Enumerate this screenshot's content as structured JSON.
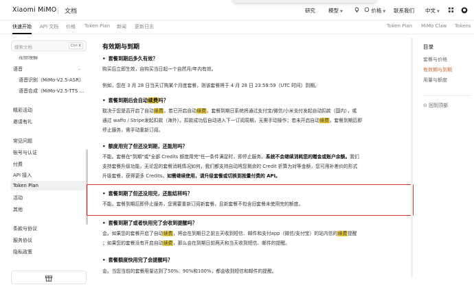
{
  "header": {
    "logo": "Xiaomi MiMO",
    "doc_label": "文档",
    "nav": [
      {
        "label": "研究",
        "chevron": false
      },
      {
        "label": "模型",
        "chevron": true
      },
      {
        "label": "价格",
        "chevron": false
      },
      {
        "label": "联系我们",
        "chevron": false
      },
      {
        "label": "中文",
        "chevron": true
      }
    ],
    "icons": [
      "lightbulb-icon",
      "grid-icon",
      "github-icon"
    ]
  },
  "subnav": {
    "left": [
      "快速开始",
      "API 文档",
      "价格",
      "Token Plan",
      "新闻",
      "更新日志"
    ],
    "right": [
      "Token Plan",
      "MiMo Claw",
      "Tokens"
    ]
  },
  "sidebar": {
    "search_placeholder": "搜索文档",
    "search_shortcut": "Ctrl K",
    "items": [
      {
        "label": "视频理解",
        "level": "sub"
      },
      {
        "label": "语音",
        "level": "top",
        "chevron": true
      },
      {
        "label": "语音识别（MiMo-V2.5-ASR）",
        "level": "sub"
      },
      {
        "label": "语音合成（MiMo-V2.5-TTS …",
        "level": "sub"
      },
      {
        "label": "精彩活动",
        "level": "top"
      },
      {
        "label": "邀请有礼",
        "level": "top"
      },
      {
        "label": "常见问题",
        "level": "top"
      },
      {
        "label": "账号与认证",
        "level": "top"
      },
      {
        "label": "付费",
        "level": "top"
      },
      {
        "label": "API 接入",
        "level": "top"
      },
      {
        "label": "Token Plan",
        "level": "top",
        "active": true
      },
      {
        "label": "活动",
        "level": "top"
      },
      {
        "label": "其他",
        "level": "top"
      },
      {
        "label": "条款与协议",
        "level": "top"
      },
      {
        "label": "服务协议",
        "level": "top"
      },
      {
        "label": "隐私政策",
        "level": "top"
      }
    ]
  },
  "content": {
    "title": "有效期与到期",
    "q1": "套餐到期后多久有效？",
    "a1": "购买后立即生效，自购买当日起一个自然月/年内有效。",
    "a1_example": "例如，您在 3 月 28 日当天订购某个月度套餐，则该套餐将于 4 月 28 日 23:59:59（UTC 时间）到期。",
    "q2_pre": "套餐到期后会自动",
    "q2_hl": "续费",
    "q2_post": "吗？",
    "a2_l1_a": "取决于您是否开启了自动",
    "a2_l1_hl1": "续费",
    "a2_l1_b": "。若已开启自动",
    "a2_l1_hl2": "续费",
    "a2_l1_c": "，套餐到期日系统将通过支付宝/微信/小米支付发起自动扣款（国内），或",
    "a2_l2_a": "通过 waffo / Stripe发起扣款（海外）。扣款成功后自动进入下一订阅周期，无需手动操作；若未开启自动",
    "a2_l2_hl": "续费",
    "a2_l2_b": "，套餐到期后即",
    "a2_l3": "停止服务，需手动重新订阅。",
    "q3": "额度用完了但还没到期，还能用吗？",
    "a3_l1_a": "不能。套餐在\"到期\"或\"全部 Credits 额度用完\"任一条件满足时，即停止服务。",
    "a3_l1_b": "系统不会继续消耗您的赠金或账户余额。",
    "a3_l1_c": "我们",
    "a3_l2": "支持套餐升级功能，无论您的套餐消耗情况如何，我们都支持自动将您剩余的 Credit 折算为对等金额，您可用补差价的形式",
    "a3_l3_a": "升级套餐，获得更多 Credits。",
    "a3_l3_b": "如需继续使用，请升级套餐或切换到按量付费的 API。",
    "q4": "套餐到期了但还没用完，还能结转吗？",
    "a4": "不能。套餐到期后即停止服务，您需要重新订阅新套餐，且新套餐不包含旧套餐未使用完的额度。",
    "q5": "套餐到期了或者快用完了会收到提醒吗？",
    "a5_l1_a": "会。如果您的套餐开启了自动",
    "a5_l1_hl1": "续费",
    "a5_l1_b": "，将会在到期日之前五天收到短信、邮件和支付app（微信/支付宝）的站内信的",
    "a5_l1_hl2": "续费",
    "a5_l1_c": "提醒",
    "a5_l2_a": "；如果您的套餐没有开启自动",
    "a5_l2_hl": "续费",
    "a5_l2_b": "，那么会在到期日前两天和当天收到短信、邮件的提醒。",
    "q6": "套餐额度快用完了会提醒吗？",
    "a6": "会。当您当前的套餐用量达到了50%、90%和100%，都会收到短信和邮件的提醒。"
  },
  "toc": {
    "title": "目录",
    "items": [
      {
        "label": "套餐与价格",
        "active": false
      },
      {
        "label": "有效期与到期",
        "active": true
      },
      {
        "label": "用量与额度",
        "active": false
      }
    ],
    "back_to_top": "回到顶部"
  }
}
